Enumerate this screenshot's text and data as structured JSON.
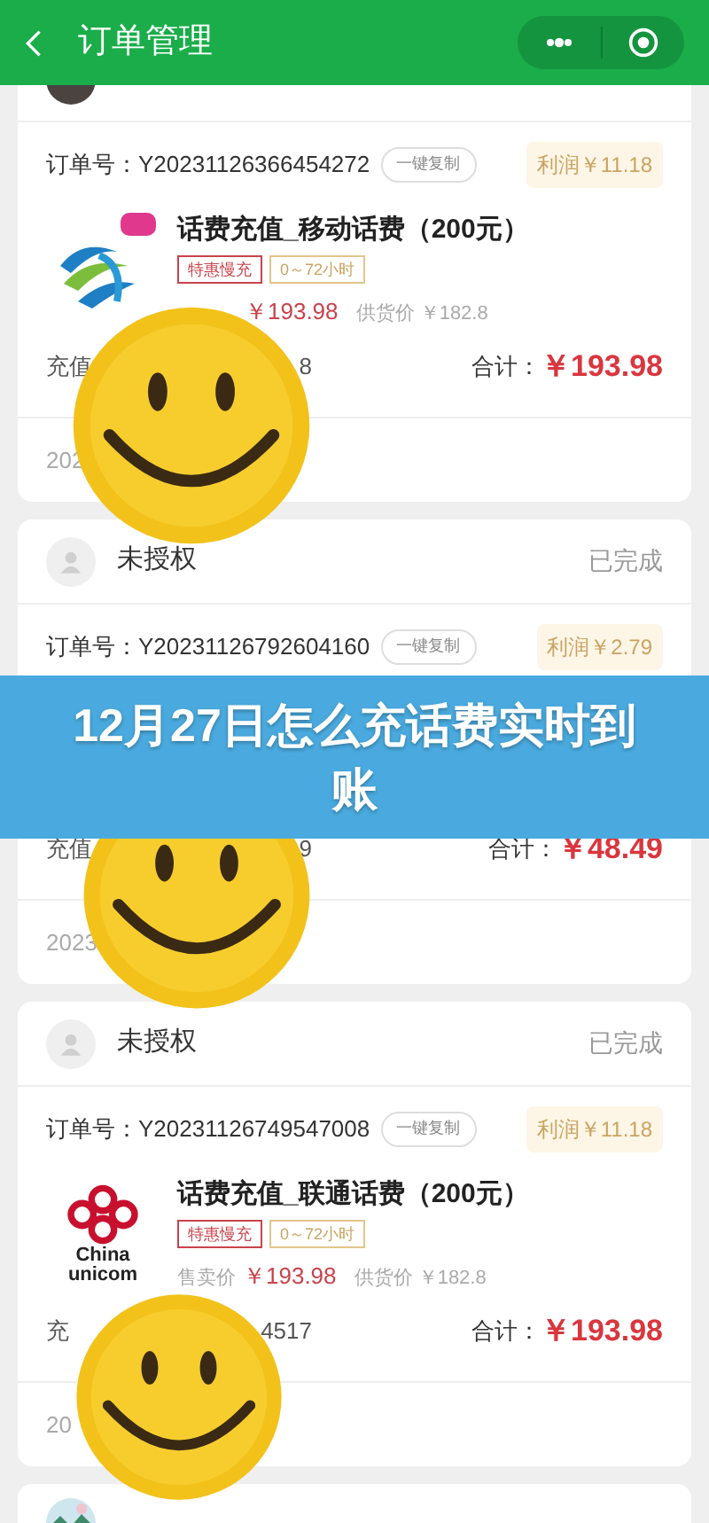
{
  "header": {
    "title": "订单管理"
  },
  "banner": {
    "text": "12月27日怎么充话费实时到账"
  },
  "orders": [
    {
      "logo": {
        "kind": "mobile"
      },
      "order_label": "订单号：",
      "order_no": "Y20231126366454272",
      "copy_label": "一键复制",
      "profit": "利润￥11.18",
      "product": {
        "title": "话费充值_移动话费（200元）",
        "tags": [
          {
            "text": "特惠慢充",
            "kind": "promo"
          },
          {
            "text": "0～72小时",
            "kind": "time"
          }
        ],
        "price": "￥193.98",
        "supply": "供货价 ￥182.8"
      },
      "recharge_head": "充值",
      "recharge_tail": "8",
      "total_label": "合计：",
      "total": "￥193.98",
      "date": "202"
    },
    {
      "user": {
        "name": "未授权",
        "status": "已完成"
      },
      "order_label": "订单号：",
      "order_no": "Y20231126792604160",
      "copy_label": "一键复制",
      "profit": "利润￥2.79",
      "recharge_head": "充值",
      "recharge_tail": "9",
      "total_label": "合计：",
      "total": "￥48.49",
      "date": "2023"
    },
    {
      "user": {
        "name": "未授权",
        "status": "已完成"
      },
      "logo": {
        "kind": "unicom",
        "text": [
          "China",
          "unicom"
        ]
      },
      "order_label": "订单号：",
      "order_no": "Y20231126749547008",
      "copy_label": "一键复制",
      "profit": "利润￥11.18",
      "product": {
        "title": "话费充值_联通话费（200元）",
        "tags": [
          {
            "text": "特惠慢充",
            "kind": "promo"
          },
          {
            "text": "0～72小时",
            "kind": "time"
          }
        ],
        "price_label": "售卖价",
        "price": "￥193.98",
        "supply": "供货价 ￥182.8"
      },
      "recharge_head": "充",
      "recharge_tail": "4517",
      "total_label": "合计：",
      "total": "￥193.98",
      "date": "20"
    }
  ]
}
